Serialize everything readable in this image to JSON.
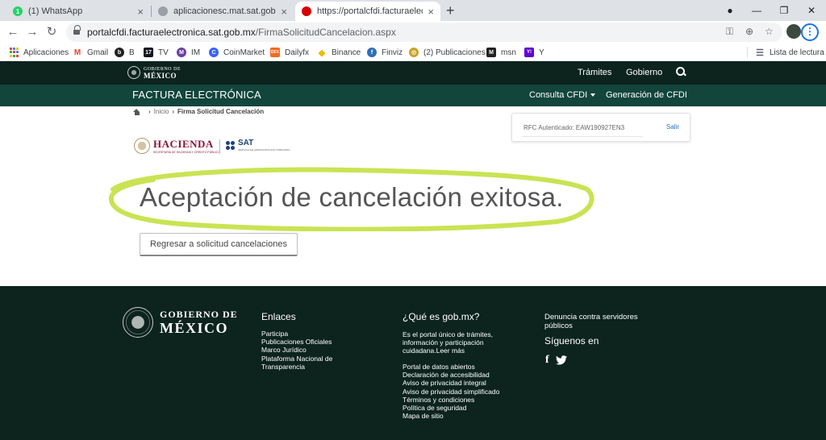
{
  "browser": {
    "tabs": [
      {
        "title": "(1) WhatsApp",
        "favicon_text": "1",
        "favicon_color": "#25d366"
      },
      {
        "title": "aplicacionesc.mat.sat.gob.mx",
        "favicon_text": "",
        "favicon_color": "#9aa0a6"
      },
      {
        "title": "https://portalcfdi.facturaelectronica",
        "favicon_text": "",
        "favicon_color": "#d50000"
      }
    ],
    "url_host": "portalcfdi.facturaelectronica.sat.gob.mx",
    "url_path": "/FirmaSolicitudCancelacion.aspx",
    "bookmarks": [
      {
        "label": "Aplicaciones",
        "icon": "apps-grid-icon",
        "color": "#4285f4",
        "glyph": ""
      },
      {
        "label": "Gmail",
        "icon": "gmail-icon",
        "color": "#ea4335",
        "glyph": "M"
      },
      {
        "label": "B",
        "icon": "b-icon",
        "color": "#222222",
        "glyph": "b"
      },
      {
        "label": "TV",
        "icon": "tradingview-icon",
        "color": "#131722",
        "glyph": "17"
      },
      {
        "label": "IM",
        "icon": "im-icon",
        "color": "#6b3fa0",
        "glyph": "M"
      },
      {
        "label": "CoinMarket",
        "icon": "coinmarket-icon",
        "color": "#3861fb",
        "glyph": "C"
      },
      {
        "label": "Dailyfx",
        "icon": "dailyfx-icon",
        "color": "#f26b21",
        "glyph": "DFX"
      },
      {
        "label": "Binance",
        "icon": "binance-icon",
        "color": "#f0b90b",
        "glyph": "◆"
      },
      {
        "label": "Finviz",
        "icon": "finviz-icon",
        "color": "#2f6db5",
        "glyph": "f"
      },
      {
        "label": "(2) Publicaciones",
        "icon": "publicaciones-icon",
        "color": "#c9a227",
        "glyph": "◎"
      },
      {
        "label": "msn",
        "icon": "msn-icon",
        "color": "#222222",
        "glyph": "M"
      },
      {
        "label": "Y",
        "icon": "yahoo-icon",
        "color": "#6001d2",
        "glyph": "Y!"
      }
    ],
    "reading_list": "Lista de lectura"
  },
  "site": {
    "gov_logo_line1": "GOBIERNO DE",
    "gov_logo_line2": "MÉXICO",
    "tramites": "Trámites",
    "gobierno": "Gobierno",
    "section_title": "FACTURA ELECTRÓNICA",
    "consulta_cfdi": "Consulta CFDI",
    "generacion_cfdi": "Generación de CFDI"
  },
  "breadcrumb": {
    "home": "Inicio",
    "current": "Firma Solicitud Cancelación"
  },
  "rfc": {
    "label": "RFC Autenticado: EAW190927EN3",
    "logout": "Salir"
  },
  "logos": {
    "hacienda": "HACIENDA",
    "hacienda_sub": "SECRETARÍA DE HACIENDA Y CRÉDITO PÚBLICO",
    "sat": "SAT",
    "sat_sub": "SERVICIO DE ADMINISTRACIÓN TRIBUTARIA"
  },
  "main": {
    "title": "Aceptación de cancelación exitosa.",
    "back_button": "Regresar a solicitud cancelaciones",
    "highlight_color": "#c6e14a"
  },
  "footer": {
    "logo_line1": "GOBIERNO DE",
    "logo_line2": "MÉXICO",
    "enlaces_heading": "Enlaces",
    "enlaces": [
      "Participa",
      "Publicaciones Oficiales",
      "Marco Jurídico",
      "Plataforma Nacional de",
      "Transparencia"
    ],
    "que_es_heading": "¿Qué es gob.mx?",
    "que_es_text_1": "Es el portal único de trámites,",
    "que_es_text_2": "información y participación",
    "que_es_text_3": "cuidadana.Leer más",
    "info_links": [
      "Portal de datos abiertos",
      "Declaración de accesibilidad",
      "Aviso de privacidad integral",
      "Aviso de privacidad simplificado",
      "Términos y condiciones",
      "Política de seguridad",
      "Mapa de sitio"
    ],
    "denuncia_1": "Denuncia contra servidores",
    "denuncia_2": "públicos",
    "siguenos": "Síguenos en"
  }
}
